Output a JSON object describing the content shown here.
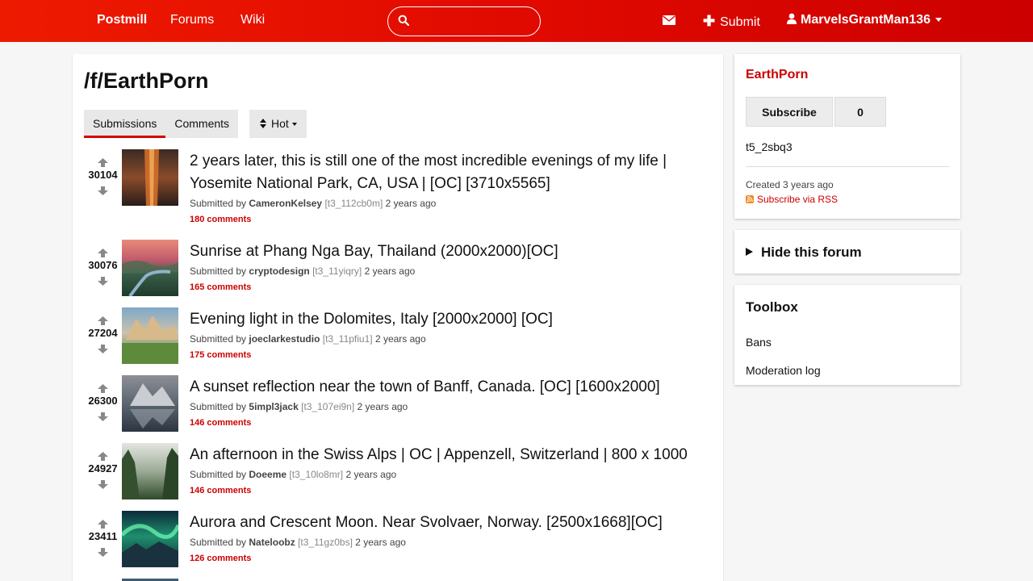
{
  "navbar": {
    "brand": "Postmill",
    "forums": "Forums",
    "wiki": "Wiki",
    "search_placeholder": "",
    "submit": "Submit",
    "username": "MarvelsGrantMan136"
  },
  "page": {
    "title": "/f/EarthPorn",
    "tabs": [
      "Submissions",
      "Comments"
    ],
    "sort": "Hot"
  },
  "submissions": [
    {
      "score": "30104",
      "title": "2 years later, this is still one of the most incredible evenings of my life | Yosemite National Park, CA, USA | [OC] [3710x5565]",
      "submitted_by": "Submitted by",
      "author": "CameronKelsey",
      "id": "[t3_112cb0m]",
      "age": "2 years ago",
      "comments": "180 comments"
    },
    {
      "score": "30076",
      "title": "Sunrise at Phang Nga Bay, Thailand (2000x2000)[OC]",
      "submitted_by": "Submitted by",
      "author": "cryptodesign",
      "id": "[t3_11yiqry]",
      "age": "2 years ago",
      "comments": "165 comments"
    },
    {
      "score": "27204",
      "title": "Evening light in the Dolomites, Italy [2000x2000] [OC]",
      "submitted_by": "Submitted by",
      "author": "joeclarkestudio",
      "id": "[t3_11pfiu1]",
      "age": "2 years ago",
      "comments": "175 comments"
    },
    {
      "score": "26300",
      "title": "A sunset reflection near the town of Banff, Canada. [OC] [1600x2000]",
      "submitted_by": "Submitted by",
      "author": "5impl3jack",
      "id": "[t3_107ei9n]",
      "age": "2 years ago",
      "comments": "146 comments"
    },
    {
      "score": "24927",
      "title": "An afternoon in the Swiss Alps | OC | Appenzell, Switzerland | 800 x 1000",
      "submitted_by": "Submitted by",
      "author": "Doeeme",
      "id": "[t3_10lo8mr]",
      "age": "2 years ago",
      "comments": "146 comments"
    },
    {
      "score": "23411",
      "title": "Aurora and Crescent Moon. Near Svolvaer, Norway. [2500x1668][OC]",
      "submitted_by": "Submitted by",
      "author": "Nateloobz",
      "id": "[t3_11gz0bs]",
      "age": "2 years ago",
      "comments": "126 comments"
    }
  ],
  "sidebar": {
    "forum_name": "EarthPorn",
    "subscribe": "Subscribe",
    "subscriber_count": "0",
    "forum_id": "t5_2sbq3",
    "created": "Created 3 years ago",
    "rss": "Subscribe via RSS",
    "hide_forum": "Hide this forum",
    "toolbox_title": "Toolbox",
    "toolbox_links": [
      "Bans",
      "Moderation log"
    ]
  },
  "colors": {
    "accent": "#cc0000",
    "navbar": "#e10a00"
  }
}
